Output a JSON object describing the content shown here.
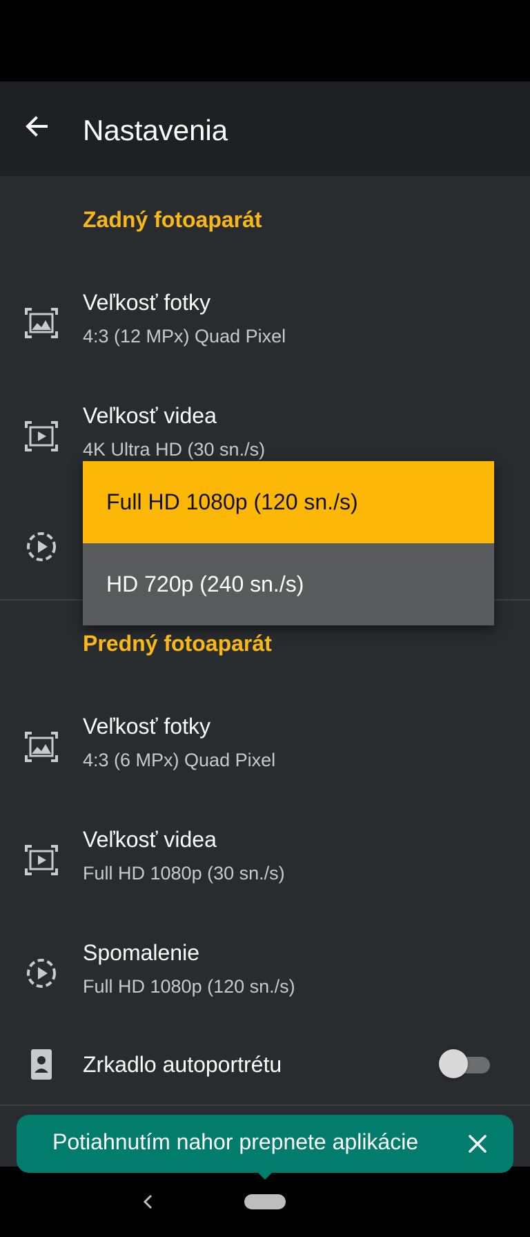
{
  "app": {
    "title": "Nastavenia"
  },
  "sections": {
    "rear": {
      "header": "Zadný fotoaparát",
      "photo_size": {
        "label": "Veľkosť fotky",
        "value": "4:3 (12 MPx) Quad Pixel"
      },
      "video_size": {
        "label": "Veľkosť videa",
        "value": "4K Ultra HD (30 sn./s)"
      }
    },
    "front": {
      "header": "Predný fotoaparát",
      "photo_size": {
        "label": "Veľkosť fotky",
        "value": "4:3 (6 MPx) Quad Pixel"
      },
      "video_size": {
        "label": "Veľkosť videa",
        "value": "Full HD 1080p (30 sn./s)"
      },
      "slow_motion": {
        "label": "Spomalenie",
        "value": "Full HD 1080p (120 sn./s)"
      },
      "selfie_mirror": {
        "label": "Zrkadlo autoportrétu",
        "enabled": false
      }
    }
  },
  "dropdown": {
    "options": [
      {
        "label": "Full HD 1080p (120 sn./s)",
        "selected": true
      },
      {
        "label": "HD 720p (240 sn./s)",
        "selected": false
      }
    ]
  },
  "toast": {
    "text": "Potiahnutím nahor prepnete aplikácie"
  },
  "colors": {
    "accent": "#f9b816",
    "background": "#282c2f",
    "appbar": "#1e2124",
    "toast": "#027d6d",
    "dropdown_selected": "#fdb707",
    "dropdown_normal": "#595a5c"
  },
  "icons": {
    "back": "arrow-left-icon",
    "photo_size": "photo-frame-icon",
    "video_size": "video-frame-icon",
    "slow_motion": "slow-motion-icon",
    "selfie_mirror": "portrait-icon",
    "toast_close": "close-icon",
    "nav_back": "chevron-left-icon"
  }
}
